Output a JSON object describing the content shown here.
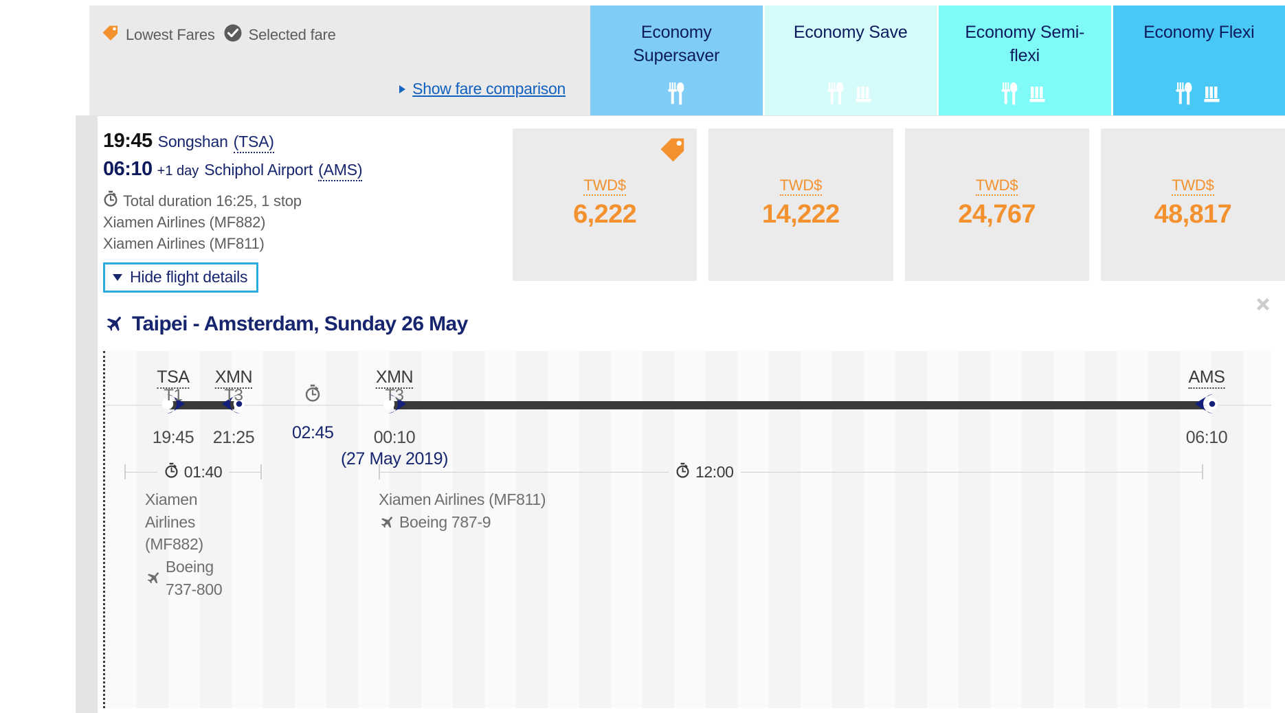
{
  "legend": {
    "lowest_fares": "Lowest Fares",
    "selected_fare": "Selected fare",
    "show_comparison": "Show fare comparison",
    "tag_icon": "price-tag-icon",
    "check_icon": "check-circle-icon",
    "triangle_icon": "triangle-right-icon"
  },
  "fare_columns": [
    {
      "title": "Economy Supersaver",
      "bg": "#7fcdf5",
      "icons": [
        "meal-icon"
      ]
    },
    {
      "title": "Economy Save",
      "bg": "#d6fbfb",
      "icons": [
        "meal-icon",
        "seat-icon"
      ]
    },
    {
      "title": "Economy Semi-flexi",
      "bg": "#7ffaf7",
      "icons": [
        "meal-icon",
        "seat-icon"
      ]
    },
    {
      "title": "Economy Flexi",
      "bg": "#4ac8f5",
      "icons": [
        "meal-icon",
        "seat-icon"
      ]
    }
  ],
  "summary": {
    "depart_time": "19:45",
    "depart_airport": "Songshan",
    "depart_code": "(TSA)",
    "arrive_time": "06:10",
    "arrive_day_offset": "+1 day",
    "arrive_airport": "Schiphol Airport",
    "arrive_code": "(AMS)",
    "duration_text": "Total duration 16:25, 1 stop",
    "stopwatch_icon": "stopwatch-icon",
    "flight_1": "Xiamen Airlines (MF882)",
    "flight_2": "Xiamen Airlines (MF811)",
    "hide_details": "Hide flight details",
    "hide_details_icon": "triangle-down-icon"
  },
  "prices": [
    {
      "currency": "TWD$",
      "amount": "6,222",
      "lowest": true
    },
    {
      "currency": "TWD$",
      "amount": "14,222",
      "lowest": false
    },
    {
      "currency": "TWD$",
      "amount": "24,767",
      "lowest": false
    },
    {
      "currency": "TWD$",
      "amount": "48,817",
      "lowest": false
    }
  ],
  "close_icon": "close-icon",
  "itinerary": {
    "title": "Taipei - Amsterdam, Sunday 26 May",
    "plane_icon": "airplane-icon",
    "nodes": [
      {
        "code": "TSA",
        "terminal": "T1",
        "time": "19:45",
        "date": ""
      },
      {
        "code": "XMN",
        "terminal": "T3",
        "time": "21:25",
        "date": ""
      },
      {
        "code": "XMN",
        "terminal": "T3",
        "time": "00:10",
        "date": "(27 May 2019)"
      },
      {
        "code": "AMS",
        "terminal": "",
        "time": "06:10",
        "date": ""
      }
    ],
    "layover": {
      "duration": "02:45",
      "icon": "stopwatch-icon"
    },
    "segments": [
      {
        "duration": "01:40",
        "airline": "Xiamen Airlines",
        "airline_cont": "(MF882)",
        "aircraft": "Boeing 737-800",
        "airline_full": "Xiamen Airlines (MF882)"
      },
      {
        "duration": "12:00",
        "airline_full": "Xiamen Airlines (MF811)",
        "aircraft": "Boeing 787-9"
      }
    ]
  },
  "colors": {
    "accent_orange": "#f4912f",
    "navy": "#16256e",
    "link_blue": "#1060c0",
    "focus_cyan": "#29abe2"
  }
}
